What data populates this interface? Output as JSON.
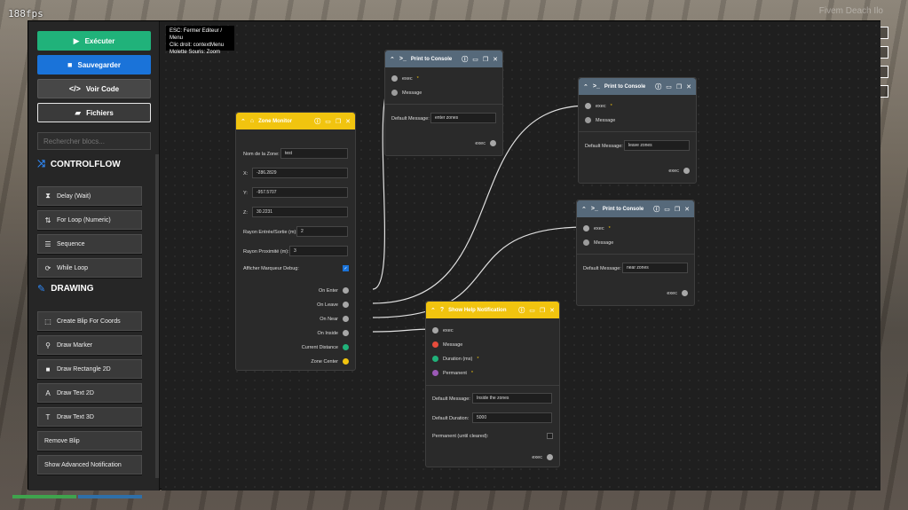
{
  "game": {
    "fps": "188fps",
    "hud_text": "Fivem Deach Ilo"
  },
  "help": {
    "lines": [
      "ESC: Fermer Editeur / Menu",
      "Clic droit: contextMenu",
      "Molette Souris: Zoom"
    ]
  },
  "sidebar": {
    "execute_label": "Exécuter",
    "save_label": "Sauvegarder",
    "code_label": "Voir Code",
    "files_label": "Fichiers",
    "search_placeholder": "Rechercher blocs...",
    "categories": [
      {
        "label": "CONTROLFLOW",
        "icon": "shuffle-icon",
        "items": [
          {
            "label": "Delay (Wait)",
            "icon": "hourglass-icon"
          },
          {
            "label": "For Loop (Numeric)",
            "icon": "sort-numeric-icon"
          },
          {
            "label": "Sequence",
            "icon": "list-ordered-icon"
          },
          {
            "label": "While Loop",
            "icon": "loop-icon"
          }
        ]
      },
      {
        "label": "DRAWING",
        "icon": "pencil-icon",
        "items": [
          {
            "label": "Create Blip For Coords",
            "icon": "blip-icon"
          },
          {
            "label": "Draw Marker",
            "icon": "marker-icon"
          },
          {
            "label": "Draw Rectangle 2D",
            "icon": "square-icon"
          },
          {
            "label": "Draw Text 2D",
            "icon": "text-icon"
          },
          {
            "label": "Draw Text 3D",
            "icon": "text-3d-icon"
          },
          {
            "label": "Remove Blip",
            "icon": ""
          },
          {
            "label": "Show Advanced Notification",
            "icon": ""
          }
        ]
      }
    ]
  },
  "nodes": {
    "zone": {
      "title": "Zone Monitor",
      "fields": {
        "name_label": "Nom de la Zone:",
        "name_value": "test",
        "x_label": "X:",
        "x_value": "-286.2829",
        "y_label": "Y:",
        "y_value": "-957.5707",
        "z_label": "Z:",
        "z_value": "30.2231",
        "radius_label": "Rayon Entrée/Sortie (m):",
        "radius_value": "2",
        "prox_label": "Rayon Proximité (m):",
        "prox_value": "3",
        "debug_label": "Afficher Marqueur Debug:"
      },
      "outputs": [
        "On Enter",
        "On Leave",
        "On Near",
        "On Inside",
        "Current Distance",
        "Zone Center"
      ]
    },
    "print1": {
      "title": "Print to Console",
      "in_exec": "exec",
      "in_message": "Message",
      "default_label": "Default Message:",
      "default_value": "enter zones",
      "out_exec": "exec"
    },
    "print2": {
      "title": "Print to Console",
      "in_exec": "exec",
      "in_message": "Message",
      "default_label": "Default Message:",
      "default_value": "leave zones",
      "out_exec": "exec"
    },
    "print3": {
      "title": "Print to Console",
      "in_exec": "exec",
      "in_message": "Message",
      "default_label": "Default Message:",
      "default_value": "near zones",
      "out_exec": "exec"
    },
    "help": {
      "title": "Show Help Notification",
      "in_exec": "exec",
      "in_message": "Message",
      "in_duration": "Duration (ms)",
      "in_permanent": "Permanent",
      "default_label": "Default Message:",
      "default_value": "Inside the zones",
      "duration_label": "Default Duration:",
      "duration_value": "5000",
      "permanent_label": "Permanent (until cleared):",
      "out_exec": "exec"
    }
  },
  "colors": {
    "execute": "#20b27a",
    "save": "#1a73d9",
    "node_header_print": "#56697a",
    "node_header_yellow": "#f1c40f",
    "pin_green": "#20b27a",
    "pin_yellow": "#f1c40f",
    "pin_red": "#e74c3c",
    "pin_purple": "#9b59b6"
  }
}
